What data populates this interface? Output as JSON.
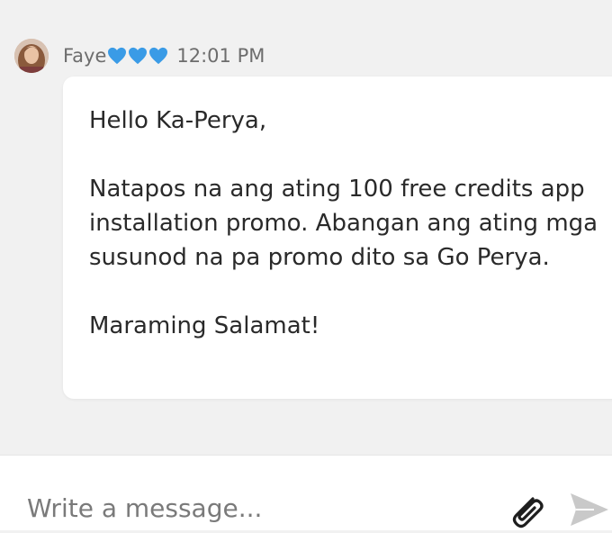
{
  "message": {
    "sender": "Faye",
    "hearts": [
      "blue-heart",
      "blue-heart",
      "blue-heart"
    ],
    "time": "12:01 PM",
    "lines": [
      "Hello Ka-Perya,",
      "Natapos na ang ating 100 free credits app installation promo. Abangan ang ating mga susunod na pa promo dito sa Go Perya.",
      "Maraming Salamat!"
    ]
  },
  "composer": {
    "placeholder": "Write a message..."
  },
  "icons": {
    "attach": "paperclip-icon",
    "send": "send-icon"
  },
  "colors": {
    "heart": "#3a9be6",
    "background": "#f1f1f1",
    "bubble": "#ffffff",
    "meta_text": "#6d6d6d",
    "body_text": "#2a2a2a"
  }
}
